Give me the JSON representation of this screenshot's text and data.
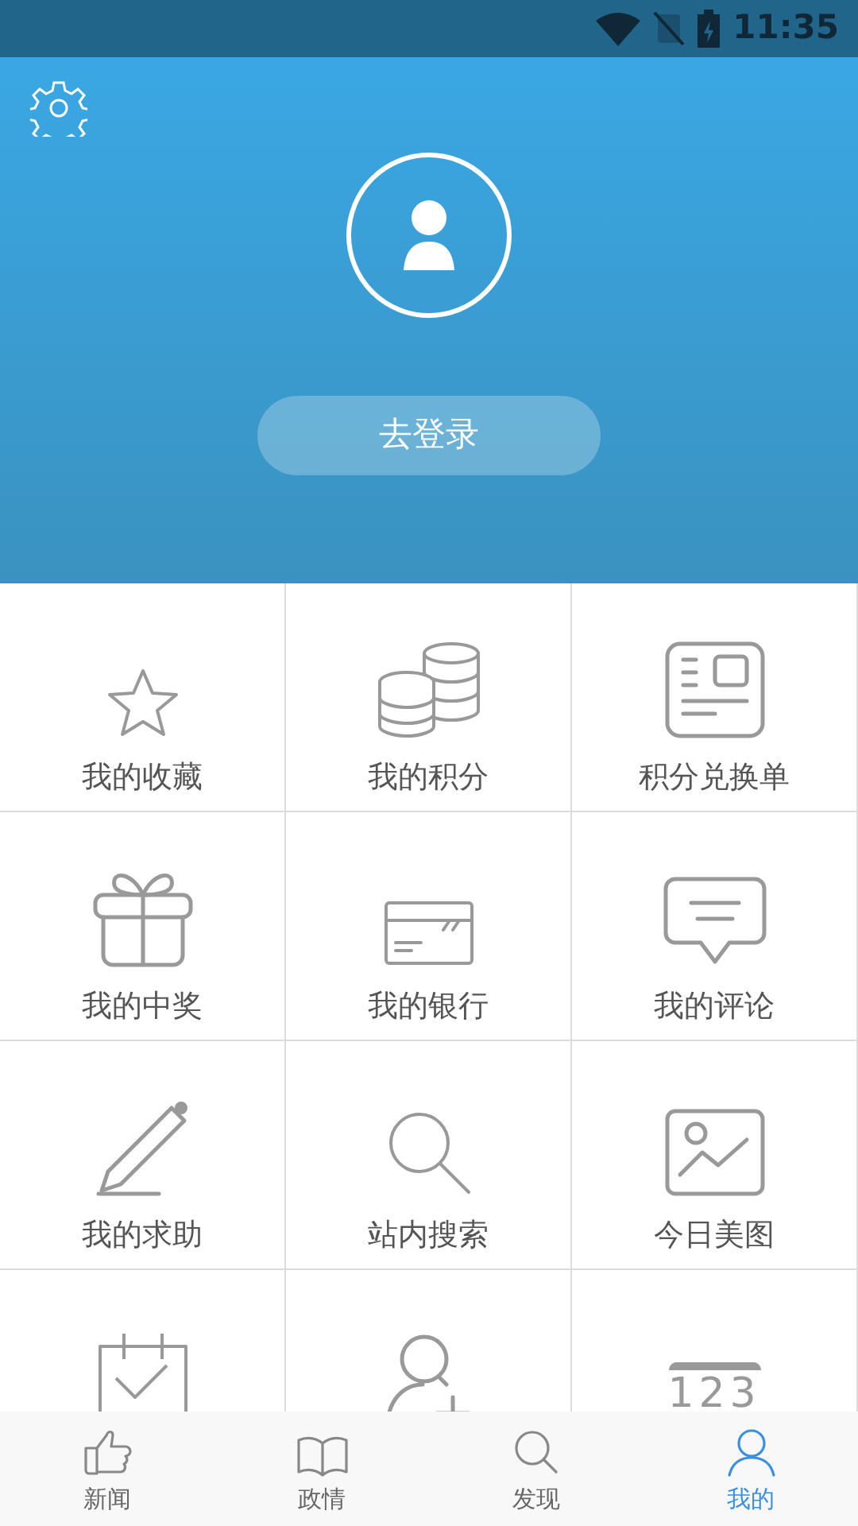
{
  "status_bar": {
    "time": "11:35"
  },
  "header": {
    "login_button": "去登录"
  },
  "grid": [
    {
      "kind": "star",
      "label": "我的收藏"
    },
    {
      "kind": "coins",
      "label": "我的积分"
    },
    {
      "kind": "voucher",
      "label": "积分兑换单"
    },
    {
      "kind": "gift",
      "label": "我的中奖"
    },
    {
      "kind": "card",
      "label": "我的银行"
    },
    {
      "kind": "comment",
      "label": "我的评论"
    },
    {
      "kind": "pencil",
      "label": "我的求助"
    },
    {
      "kind": "search",
      "label": "站内搜索"
    },
    {
      "kind": "image",
      "label": "今日美图"
    },
    {
      "kind": "calendar"
    },
    {
      "kind": "user-add"
    },
    {
      "kind": "number",
      "icon_text": "123"
    }
  ],
  "tabs": [
    {
      "kind": "thumb",
      "label": "新闻",
      "selected": false
    },
    {
      "kind": "book",
      "label": "政情",
      "selected": false
    },
    {
      "kind": "search",
      "label": "发现",
      "selected": false
    },
    {
      "kind": "user",
      "label": "我的",
      "selected": true
    }
  ]
}
